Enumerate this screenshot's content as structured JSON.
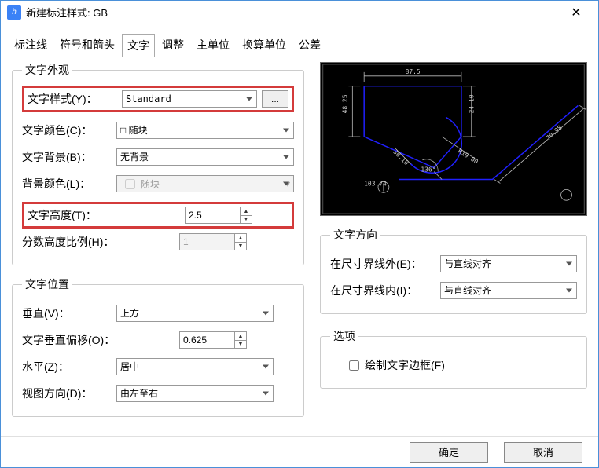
{
  "window": {
    "title": "新建标注样式: GB"
  },
  "tabs": {
    "line": "标注线",
    "symbols": "符号和箭头",
    "text": "文字",
    "fit": "调整",
    "primary": "主单位",
    "alt": "换算单位",
    "tol": "公差"
  },
  "appearance": {
    "legend": "文字外观",
    "style_label": "文字样式(Y)：",
    "style_value": "Standard",
    "ellipsis": "...",
    "color_label": "文字颜色(C)：",
    "color_value": "随块",
    "bg_label": "文字背景(B)：",
    "bg_value": "无背景",
    "bgcolor_label": "背景颜色(L)：",
    "bgcolor_value": "随块",
    "height_label": "文字高度(T)：",
    "height_value": "2.5",
    "frac_label": "分数高度比例(H)：",
    "frac_value": "1"
  },
  "position": {
    "legend": "文字位置",
    "vert_label": "垂直(V)：",
    "vert_value": "上方",
    "offset_label": "文字垂直偏移(O)：",
    "offset_value": "0.625",
    "horiz_label": "水平(Z)：",
    "horiz_value": "居中",
    "viewdir_label": "视图方向(D)：",
    "viewdir_value": "由左至右"
  },
  "direction": {
    "legend": "文字方向",
    "outside_label": "在尺寸界线外(E)：",
    "outside_value": "与直线对齐",
    "inside_label": "在尺寸界线内(I)：",
    "inside_value": "与直线对齐"
  },
  "options": {
    "legend": "选项",
    "frame_label": "绘制文字边框(F)"
  },
  "footer": {
    "ok": "确定",
    "cancel": "取消"
  },
  "preview": {
    "dim_top": "87.5",
    "dim_left": "48.25",
    "dim_v": "24.10",
    "dim_r": "R19.00",
    "dim_oblique": "30.10",
    "dim_angle": "136°",
    "dim_linear": "103.74",
    "dim_right": "70.98"
  }
}
